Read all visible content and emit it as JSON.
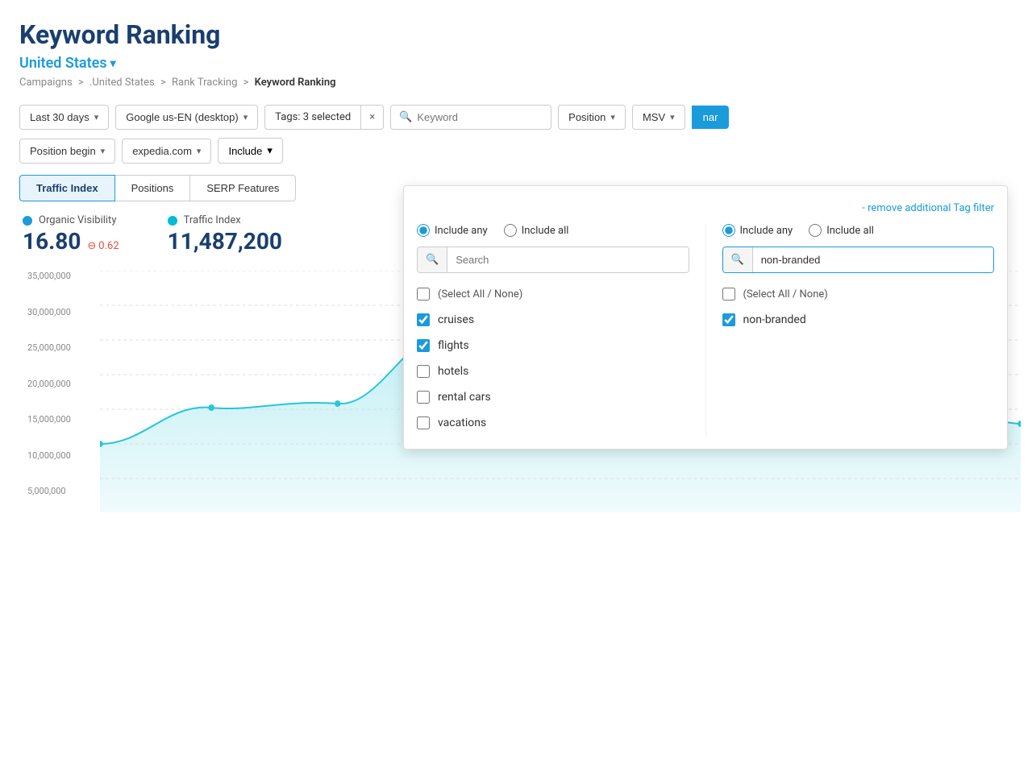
{
  "page": {
    "title": "Keyword Ranking",
    "country": "United States",
    "breadcrumb": {
      "parts": [
        "Campaigns",
        ".United States",
        "Rank Tracking"
      ],
      "current": "Keyword Ranking"
    }
  },
  "toolbar": {
    "date_range": "Last 30 days",
    "engine": "Google us-EN (desktop)",
    "tags_label": "Tags: 3 selected",
    "tags_close": "×",
    "keyword_placeholder": "Keyword",
    "position_label": "Position",
    "msv_label": "MSV",
    "position_begin_label": "Position begin",
    "domain_label": "expedia.com",
    "include_label": "Include"
  },
  "tabs": {
    "items": [
      "Traffic Index",
      "Positions",
      "SERP Features"
    ],
    "active": 0
  },
  "metrics": [
    {
      "label": "Organic Visibility",
      "dot_color": "#1a9bdb",
      "value": "16.80",
      "change": "0.62",
      "change_dir": "down"
    },
    {
      "label": "Traffic Index",
      "dot_color": "#00bcd4",
      "value": "11,487,200",
      "change": null
    }
  ],
  "chart": {
    "y_labels": [
      "35,000,000",
      "30,000,000",
      "25,000,000",
      "20,000,000",
      "15,000,000",
      "10,000,000",
      "5,000,000"
    ]
  },
  "dropdown": {
    "remove_filter_label": "- remove additional Tag filter",
    "panel_left": {
      "radio_any": "Include any",
      "radio_all": "Include all",
      "radio_any_selected": true,
      "search_placeholder": "Search",
      "items": [
        {
          "label": "(Select All / None)",
          "checked": false,
          "is_select_all": true
        },
        {
          "label": "cruises",
          "checked": true
        },
        {
          "label": "flights",
          "checked": true
        },
        {
          "label": "hotels",
          "checked": false
        },
        {
          "label": "rental cars",
          "checked": false
        },
        {
          "label": "vacations",
          "checked": false
        }
      ]
    },
    "panel_right": {
      "radio_any": "Include any",
      "radio_all": "Include all",
      "radio_any_selected": true,
      "search_value": "non-branded",
      "items": [
        {
          "label": "(Select All / None)",
          "checked": false,
          "is_select_all": true
        },
        {
          "label": "non-branded",
          "checked": true
        }
      ]
    }
  },
  "colors": {
    "primary_blue": "#1a3f6f",
    "accent_blue": "#1a9bdb",
    "chart_line": "#26c6da",
    "chart_fill": "#b2ebf2"
  }
}
